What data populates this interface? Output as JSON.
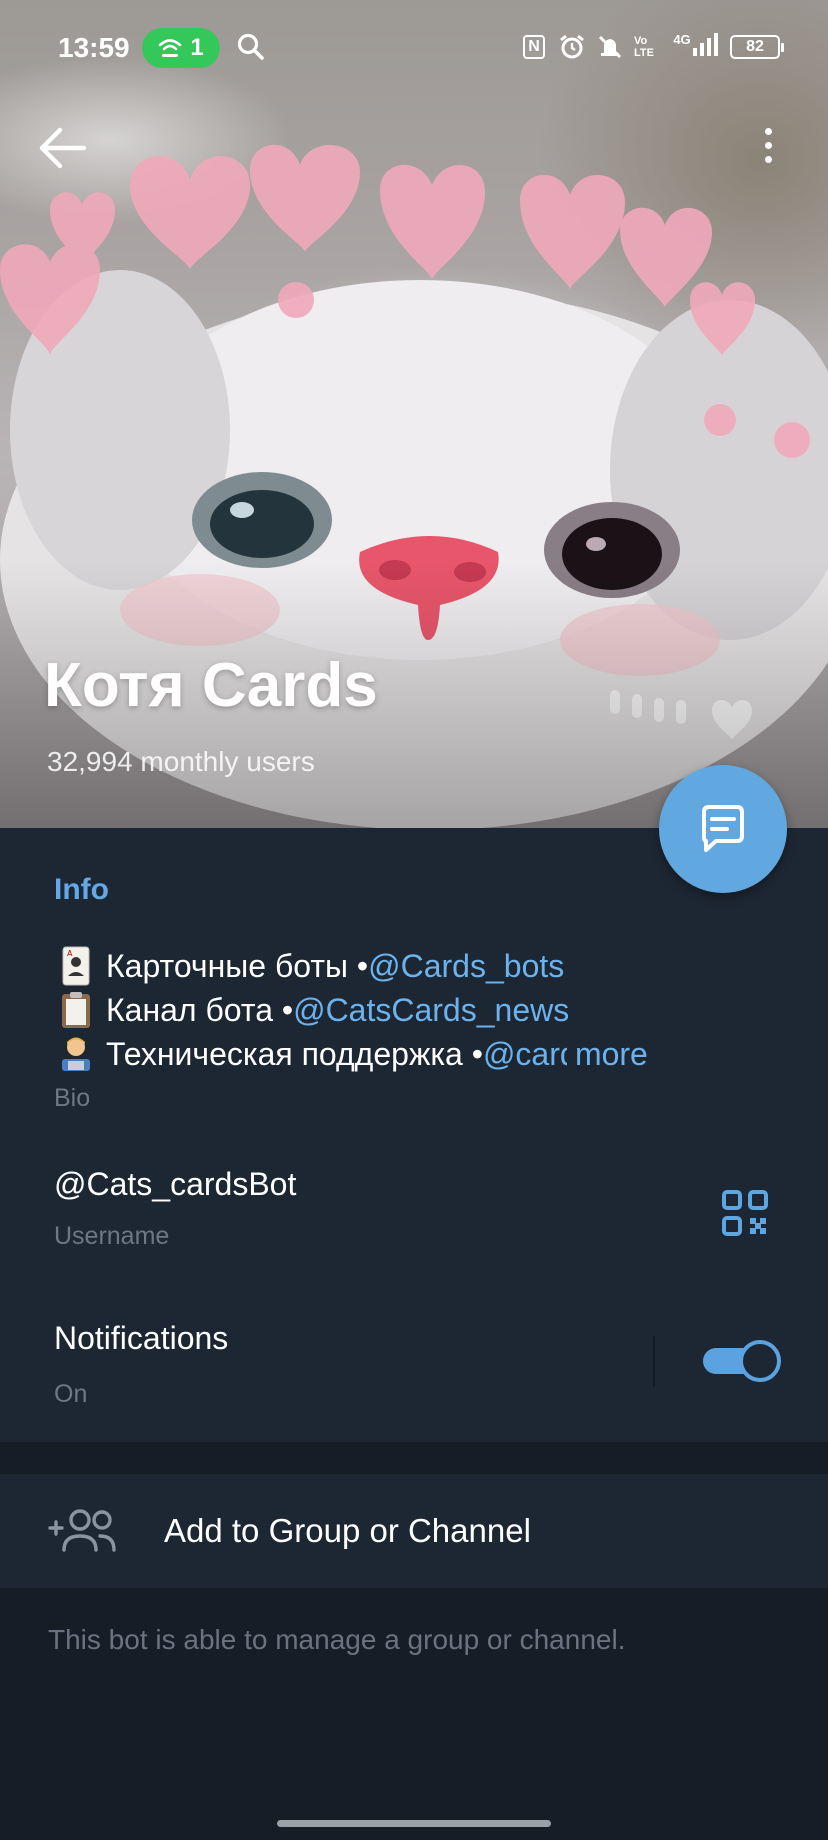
{
  "status_bar": {
    "time": "13:59",
    "hotspot_count": "1",
    "nfc": "N",
    "network": "4G",
    "volte": "Vo LTE",
    "battery": "82"
  },
  "header": {
    "title": "Котя Cards",
    "subtitle": "32,994 monthly users"
  },
  "info": {
    "section_title": "Info",
    "bio": {
      "line1_text": "Карточные боты • ",
      "line1_link": "@Cards_bots",
      "line2_text": "Канал бота • ",
      "line2_link": "@CatsCards_news",
      "line3_text": "Техническая поддержка • ",
      "line3_link": "@cardı",
      "more": "more",
      "caption": "Bio"
    },
    "username": {
      "value": "@Cats_cardsBot",
      "caption": "Username"
    },
    "notifications": {
      "label": "Notifications",
      "value": "On",
      "enabled": true
    }
  },
  "actions": {
    "add_to_group": "Add to Group or Channel",
    "note": "This bot is able to manage a group or channel."
  },
  "colors": {
    "background": "#1d2733",
    "accent": "#64a8e6",
    "fab": "#62a8e0",
    "muted": "#6d7883"
  },
  "icons": {
    "back": "arrow-left-icon",
    "menu": "more-vertical-icon",
    "fab": "message-icon",
    "qr": "qr-code-icon",
    "add": "add-people-icon",
    "search": "search-icon",
    "hotspot": "hotspot-icon",
    "alarm": "alarm-icon",
    "mute": "bell-off-icon",
    "signal": "signal-icon"
  }
}
